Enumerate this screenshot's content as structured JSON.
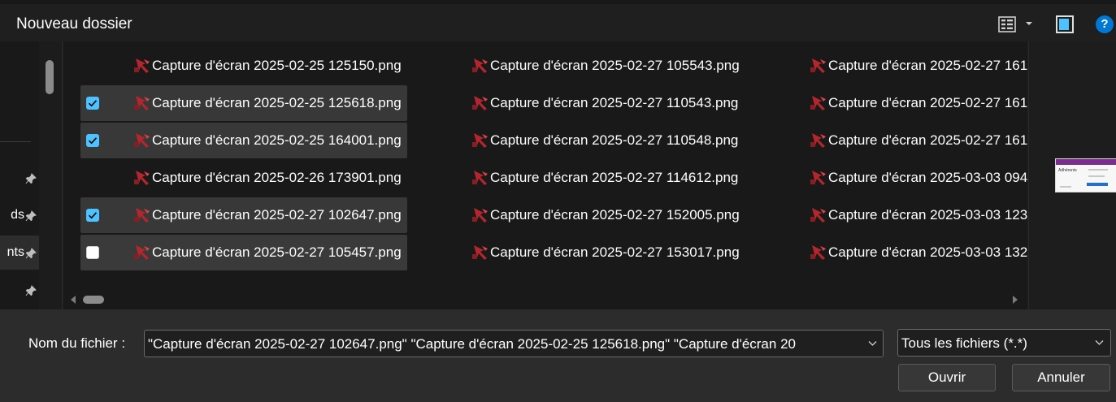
{
  "toolbar": {
    "title": "Nouveau dossier",
    "view_icon": "details-view-icon",
    "preview_icon": "preview-pane-icon",
    "help_icon": "help-icon",
    "help_glyph": "?"
  },
  "nav": {
    "items": [
      {
        "label": ""
      },
      {
        "label": "ds"
      },
      {
        "label": "nts"
      },
      {
        "label": ""
      }
    ]
  },
  "files": {
    "columns": [
      [
        {
          "name": "Capture d'écran 2025-02-25 125150.png",
          "checked": false,
          "selected": false
        },
        {
          "name": "Capture d'écran 2025-02-25 125618.png",
          "checked": true,
          "selected": true
        },
        {
          "name": "Capture d'écran 2025-02-25 164001.png",
          "checked": true,
          "selected": true
        },
        {
          "name": "Capture d'écran 2025-02-26 173901.png",
          "checked": false,
          "selected": false
        },
        {
          "name": "Capture d'écran 2025-02-27 102647.png",
          "checked": true,
          "selected": true
        },
        {
          "name": "Capture d'écran 2025-02-27 105457.png",
          "checked": false,
          "selected": false,
          "hovered": true
        }
      ],
      [
        {
          "name": "Capture d'écran 2025-02-27 105543.png"
        },
        {
          "name": "Capture d'écran 2025-02-27 110543.png"
        },
        {
          "name": "Capture d'écran 2025-02-27 110548.png"
        },
        {
          "name": "Capture d'écran 2025-02-27 114612.png"
        },
        {
          "name": "Capture d'écran 2025-02-27 152005.png"
        },
        {
          "name": "Capture d'écran 2025-02-27 153017.png"
        }
      ],
      [
        {
          "name": "Capture d'écran 2025-02-27 161"
        },
        {
          "name": "Capture d'écran 2025-02-27 161"
        },
        {
          "name": "Capture d'écran 2025-02-27 161"
        },
        {
          "name": "Capture d'écran 2025-03-03 094"
        },
        {
          "name": "Capture d'écran 2025-03-03 123"
        },
        {
          "name": "Capture d'écran 2025-03-03 132"
        }
      ]
    ]
  },
  "preview": {
    "thumbnail_title": "Adhérents"
  },
  "bottom": {
    "filename_label": "Nom du fichier :",
    "filename_value": "\"Capture d'écran 2025-02-27 102647.png\" \"Capture d'écran 2025-02-25 125618.png\" \"Capture d'écran 20",
    "filetype_value": "Tous les fichiers (*.*)",
    "open_label": "Ouvrir",
    "cancel_label": "Annuler"
  },
  "colors": {
    "accent": "#4cc2ff",
    "help_blue": "#0078d4",
    "file_icon_red": "#b3262e"
  }
}
